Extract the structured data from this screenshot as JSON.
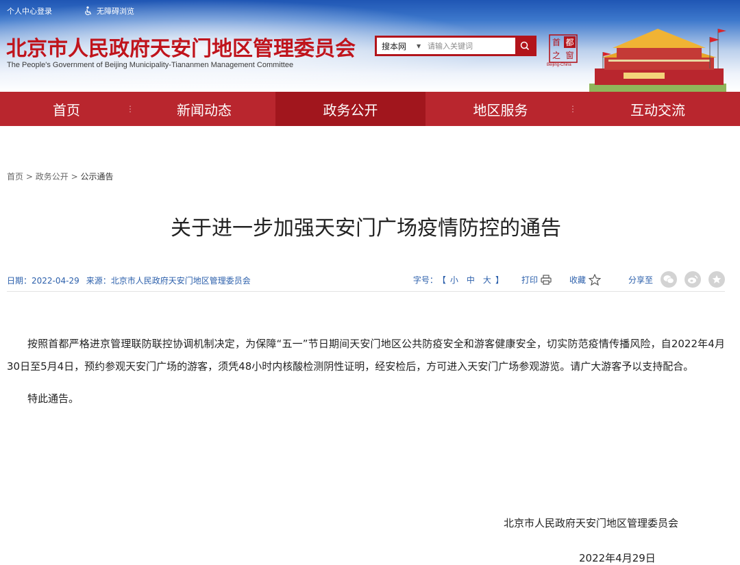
{
  "header": {
    "top_links": {
      "login": "个人中心登录",
      "accessibility": "无障碍浏览"
    },
    "site_title": "北京市人民政府天安门地区管理委员会",
    "site_subtitle": "The People's Government of Beijing Municipality-Tiananmen Management Committee",
    "search": {
      "scope": "搜本网",
      "placeholder": "请输入关键词"
    },
    "seal": {
      "chars": [
        "首",
        "都",
        "之",
        "窗"
      ],
      "caption": "Beijing-China"
    }
  },
  "nav": {
    "items": [
      {
        "label": "首页"
      },
      {
        "label": "新闻动态"
      },
      {
        "label": "政务公开"
      },
      {
        "label": "地区服务"
      },
      {
        "label": "互动交流"
      }
    ]
  },
  "breadcrumb": {
    "home": "首页",
    "sep": ">",
    "section": "政务公开",
    "current": "公示通告"
  },
  "article": {
    "title": "关于进一步加强天安门广场疫情防控的通告",
    "meta": {
      "date_label": "日期：",
      "date": "2022-04-29",
      "source_label": "来源：",
      "source": "北京市人民政府天安门地区管理委员会",
      "font_size_label": "字号：",
      "bracket_open": "【",
      "bracket_close": "】",
      "sizes": [
        "小",
        "中",
        "大"
      ],
      "print": "打印",
      "favorite": "收藏",
      "share": "分享至"
    },
    "paragraphs": [
      "按照首都严格进京管理联防联控协调机制决定，为保障“五一”节日期间天安门地区公共防疫安全和游客健康安全，切实防范疫情传播风险，自2022年4月30日至5月4日，预约参观天安门广场的游客，须凭48小时内核酸检测阴性证明，经安检后，方可进入天安门广场参观游览。请广大游客予以支持配合。",
      "特此通告。"
    ],
    "signature": "北京市人民政府天安门地区管理委员会",
    "sign_date": "2022年4月29日"
  },
  "colors": {
    "brand_red": "#b9262e",
    "nav_active": "#a1161d",
    "link_blue": "#2b5fab",
    "header_blue": "#1f56b4"
  }
}
